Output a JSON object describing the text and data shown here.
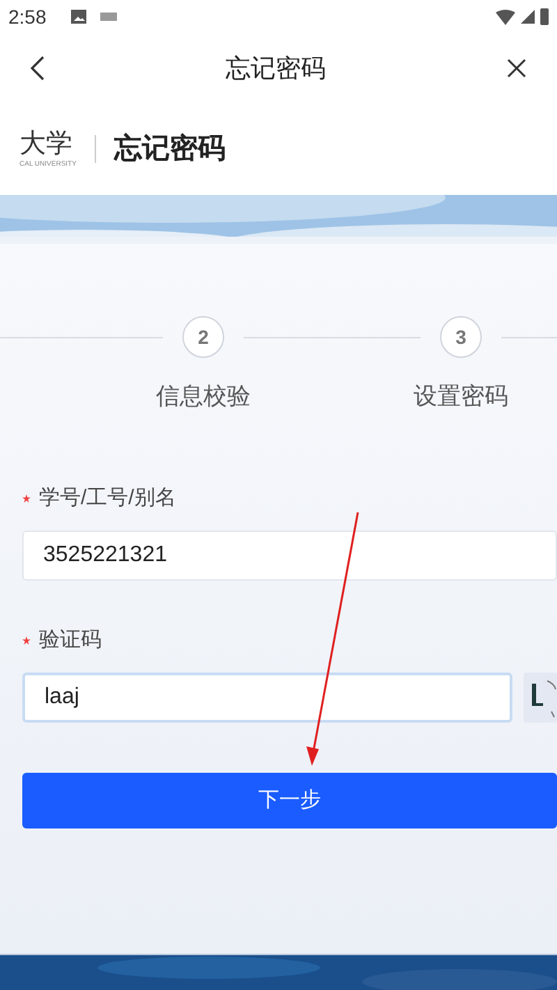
{
  "status_bar": {
    "time": "2:58"
  },
  "nav": {
    "title": "忘记密码"
  },
  "header": {
    "school": "大学",
    "school_en": "CAL UNIVERSITY",
    "page_title": "忘记密码"
  },
  "steps": [
    {
      "number": "2",
      "label": "信息校验"
    },
    {
      "number": "3",
      "label": "设置密码"
    }
  ],
  "form": {
    "fields": [
      {
        "kind": "text",
        "label": "学号/工号/别名",
        "required": true,
        "value": "3525221321",
        "focused": false
      },
      {
        "kind": "captcha",
        "label": "验证码",
        "required": true,
        "value": "laaj",
        "focused": true
      }
    ],
    "submit": "下一步"
  }
}
